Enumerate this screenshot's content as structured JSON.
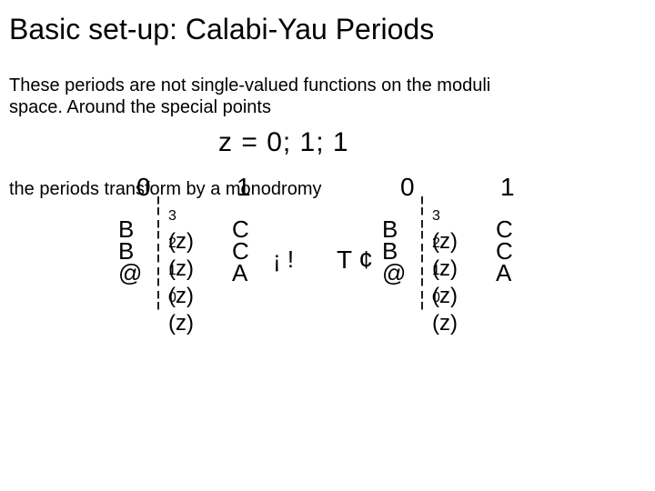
{
  "title": "Basic set-up: Calabi-Yau Periods",
  "para1_a": "These periods are not single-valued functions on the moduli",
  "para1_b": "space. Around the special points",
  "eq1": "z = 0; 1; 1",
  "para2": "the periods transform by a monodromy",
  "corners": {
    "tl": "0",
    "tr": "1"
  },
  "bracket": {
    "B": "B",
    "at": "@",
    "C": "C",
    "A": "A"
  },
  "bar_char": "¦",
  "rows": {
    "r3": {
      "sub": "3",
      "fn": "(z)"
    },
    "r2": {
      "sub": "2",
      "fn": "(z)"
    },
    "r1": {
      "sub": "1",
      "fn": "(z)"
    },
    "r0": {
      "sub": "0",
      "fn": "(z)"
    }
  },
  "arrow": "¡ !",
  "Tdot": "T ¢"
}
